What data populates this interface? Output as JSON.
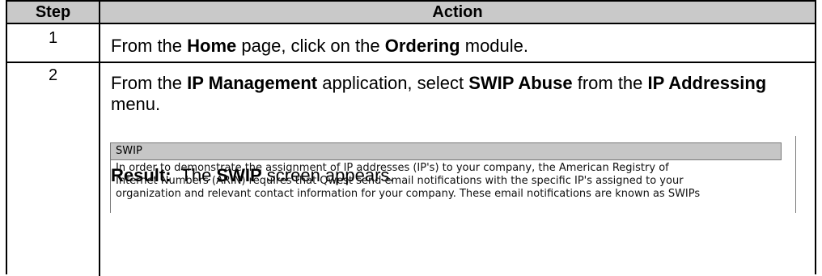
{
  "table": {
    "headers": {
      "step": "Step",
      "action": "Action"
    },
    "rows": [
      {
        "step": "1",
        "parts": [
          "From the ",
          "Home",
          " page, click on the ",
          "Ordering",
          " module."
        ]
      },
      {
        "step": "2",
        "parts": [
          "From the ",
          "IP Management",
          " application, select ",
          "SWIP Abuse",
          " from the ",
          "IP Addressing",
          " menu."
        ],
        "result_parts": [
          "Result:",
          "  The ",
          "SWIP",
          " screen appears."
        ]
      }
    ]
  },
  "screenshot": {
    "title": "SWIP",
    "lines": [
      "In order to demonstrate the assignment of IP addresses (IP's) to your company, the American Registry of",
      "Internet Numbers (ARIN) requires that Qwest send email notifications with the specific IP's assigned to your",
      "organization and relevant contact information for your company. These email notifications are known as SWIPs"
    ]
  }
}
